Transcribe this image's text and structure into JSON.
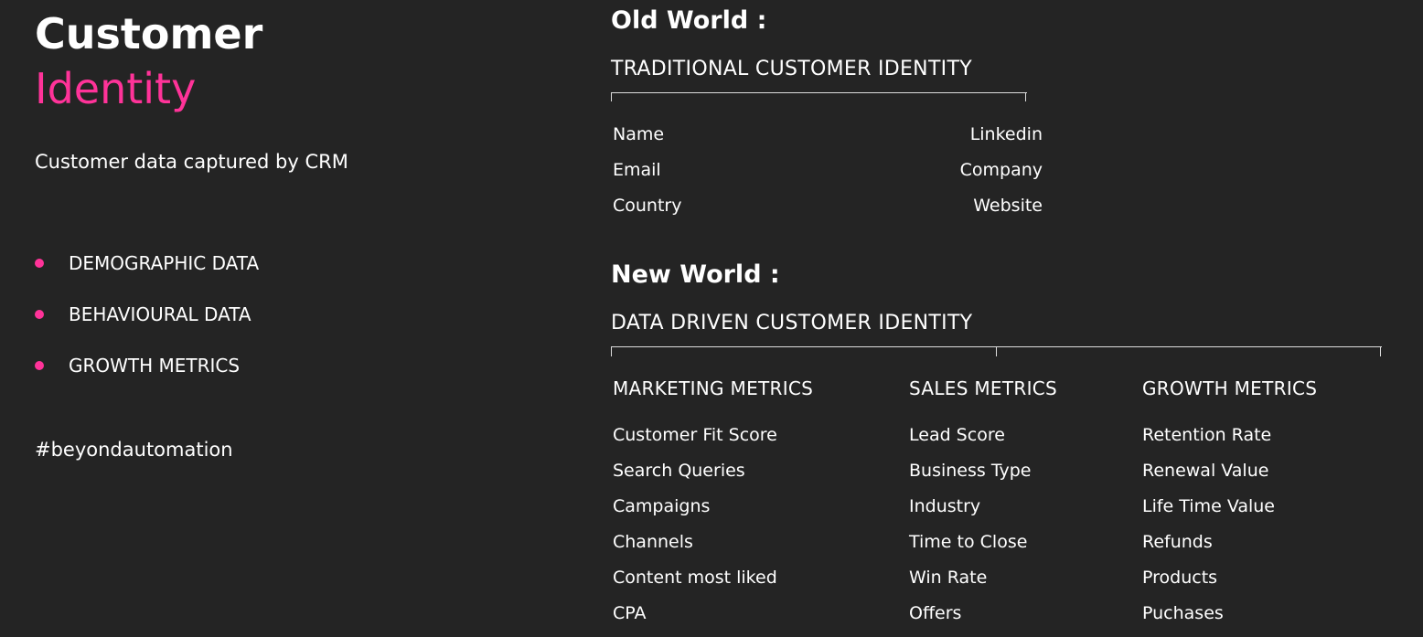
{
  "left": {
    "title_line1": "Customer",
    "title_line2": "Identity",
    "subtitle": "Customer data captured by CRM",
    "bullets": [
      "DEMOGRAPHIC DATA",
      "BEHAVIOURAL DATA",
      "GROWTH METRICS"
    ],
    "hashtag": "#beyondautomation"
  },
  "old_world": {
    "heading": "Old World :",
    "subheading": "TRADITIONAL CUSTOMER IDENTITY",
    "left_fields": [
      "Name",
      "Email",
      "Country"
    ],
    "right_fields": [
      "Linkedin",
      "Company",
      "Website"
    ]
  },
  "new_world": {
    "heading": "New World :",
    "subheading": "DATA DRIVEN CUSTOMER IDENTITY",
    "columns": [
      {
        "title": "MARKETING METRICS",
        "items": [
          "Customer Fit Score",
          "Search Queries",
          "Campaigns",
          "Channels",
          "Content most liked",
          "CPA"
        ]
      },
      {
        "title": "SALES METRICS",
        "items": [
          "Lead Score",
          "Business Type",
          "Industry",
          "Time to Close",
          "Win Rate",
          "Offers"
        ]
      },
      {
        "title": "GROWTH METRICS",
        "items": [
          "Retention Rate",
          "Renewal Value",
          "Life Time Value",
          "Refunds",
          "Products",
          "Puchases"
        ]
      }
    ]
  },
  "colors": {
    "background": "#242424",
    "accent": "#ff3399",
    "text": "#ffffff"
  }
}
